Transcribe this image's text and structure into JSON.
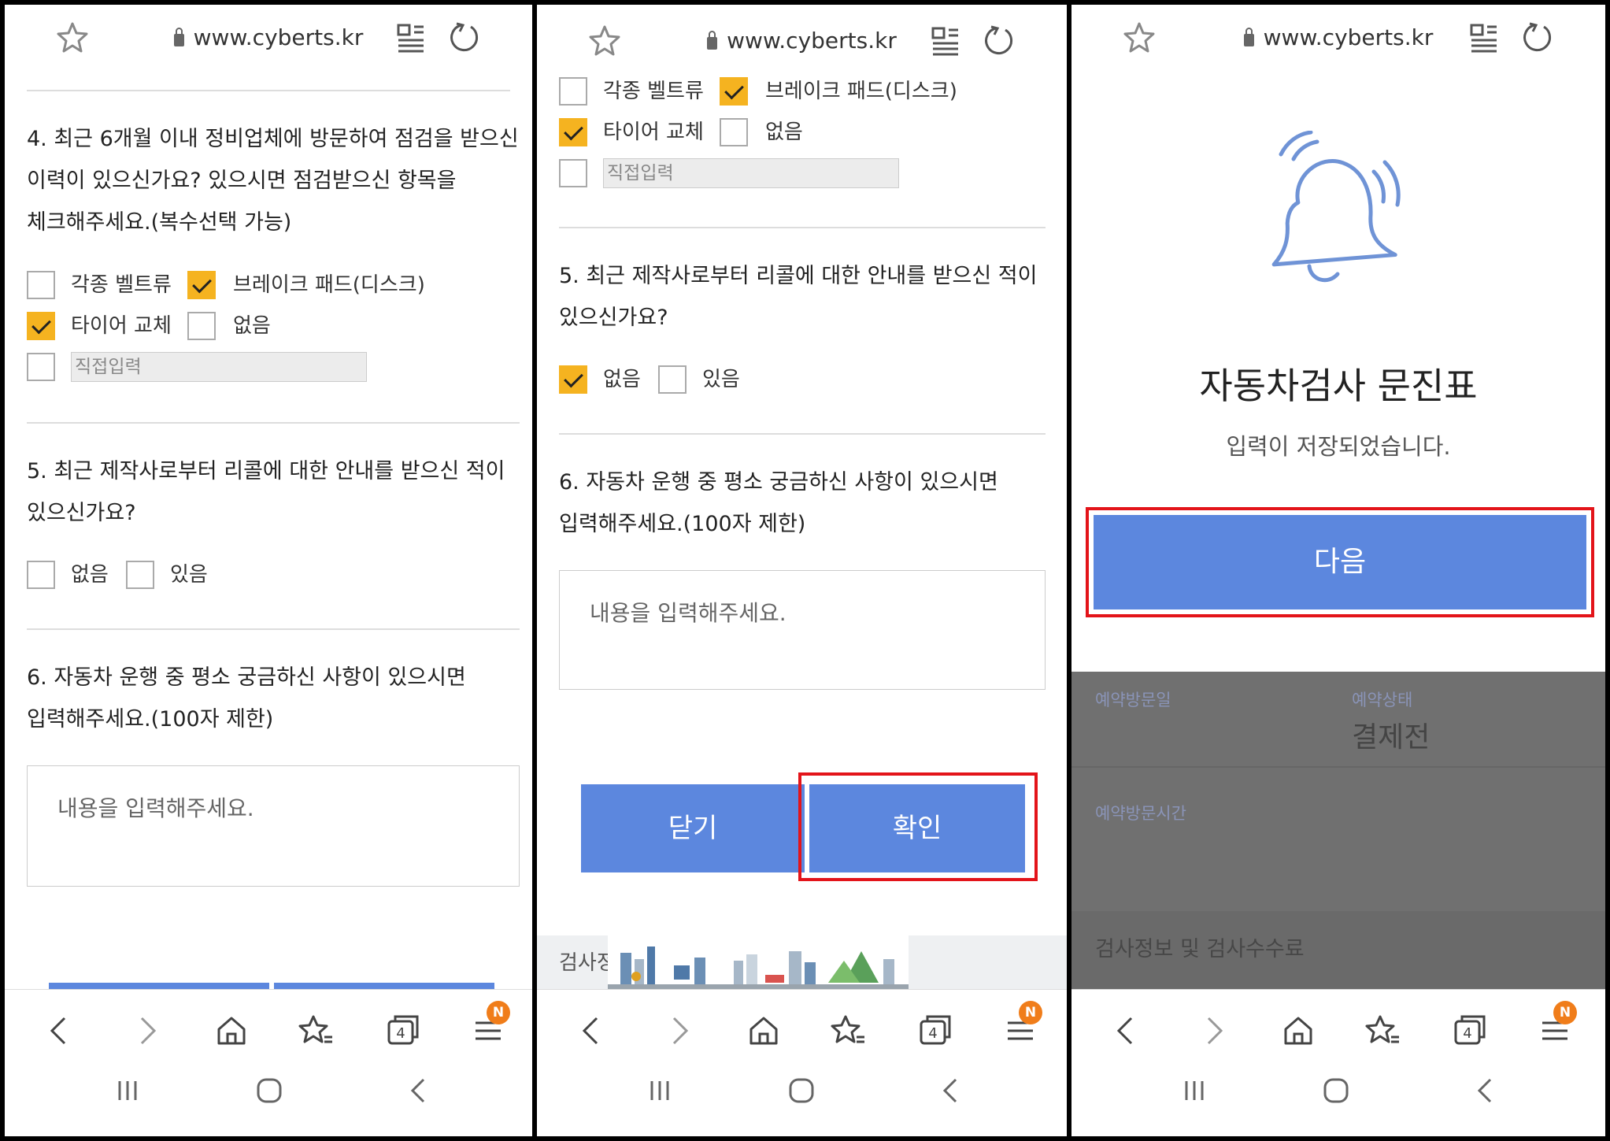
{
  "browser": {
    "url": "www.cyberts.kr",
    "tab_count": "4",
    "menu_badge": "N"
  },
  "form": {
    "q4_line1": "4. 최근 6개월 이내 정비업체에 방문하여 점검을 받으신",
    "q4_line2": "이력이 있으신가요? 있으시면 점검받으신 항목을",
    "q4_line3": "체크해주세요.(복수선택 가능)",
    "q4_options": {
      "belt": "각종 벨트류",
      "brake": "브레이크 패드(디스크)",
      "tire": "타이어 교체",
      "none": "없음"
    },
    "q4_checked": {
      "belt": false,
      "brake": true,
      "tire": true,
      "none": false
    },
    "q4_direct_input": "직접입력",
    "q5_line1": "5. 최근 제작사로부터 리콜에 대한 안내를 받으신 적이",
    "q5_line2": "있으신가요?",
    "q5_options": {
      "no": "없음",
      "yes": "있음"
    },
    "q6_line1": "6. 자동차 운행 중 평소 궁금하신 사항이 있으시면",
    "q6_line2": "입력해주세요.(100자 제한)",
    "q6_placeholder": "내용을 입력해주세요."
  },
  "panel1": {
    "q5_selected": "none"
  },
  "panel2": {
    "q5_selected": "없음",
    "close_button": "닫기",
    "confirm_button": "확인",
    "banner_label": "검사정"
  },
  "panel3": {
    "title": "자동차검사 문진표",
    "message": "입력이 저장되었습니다.",
    "next_button": "다음",
    "reservation_date_label": "예약방문일",
    "reservation_status_label": "예약상태",
    "reservation_status_value": "결제전",
    "reservation_time_label": "예약방문시간",
    "inspection_info_label": "검사정보 및 검사수수료"
  },
  "colors": {
    "button_blue": "#5c87de",
    "check_yellow": "#f5b320",
    "highlight_red": "#e3141a",
    "badge_orange": "#f07d1a"
  },
  "icons": {
    "topbar": [
      "star-icon",
      "lock-icon",
      "reader-icon",
      "reload-icon"
    ],
    "bottombar": [
      "back-icon",
      "forward-icon",
      "home-icon",
      "bookmarks-icon",
      "tabs-icon",
      "menu-icon"
    ],
    "system": [
      "recents-icon",
      "home-button-icon",
      "system-back-icon"
    ],
    "dialog": "bell-icon"
  }
}
